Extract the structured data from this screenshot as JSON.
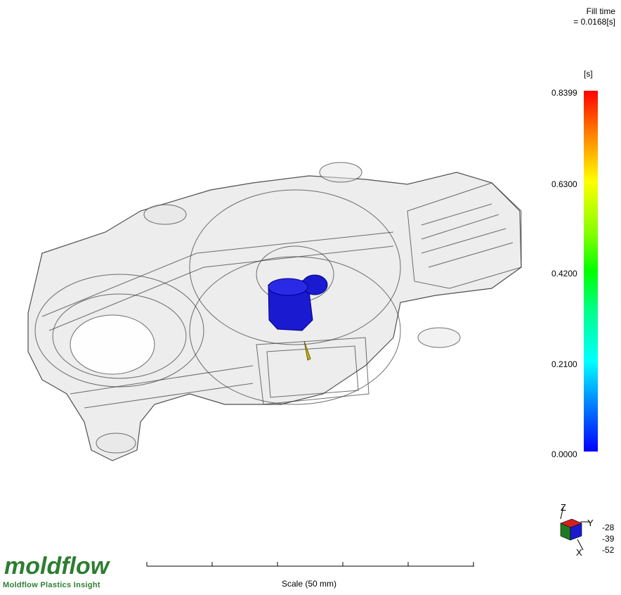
{
  "header": {
    "title_line1": "Fill time",
    "title_line2": "= 0.0168[s]"
  },
  "legend": {
    "unit": "[s]",
    "ticks": [
      "0.8399",
      "0.6300",
      "0.4200",
      "0.2100",
      "0.0000"
    ],
    "colors": {
      "high": "#ff0000",
      "mid": "#00ff00",
      "low": "#0000ff"
    }
  },
  "orientation": {
    "z_label": "Z",
    "y_label": "Y",
    "x_label": "X",
    "values": [
      "-28",
      "-39",
      "-52"
    ]
  },
  "scale": {
    "label": "Scale (50 mm)"
  },
  "branding": {
    "logo_text": "moldflow",
    "product_name": "Moldflow Plastics Insight",
    "logo_color": "#2e7d32"
  }
}
